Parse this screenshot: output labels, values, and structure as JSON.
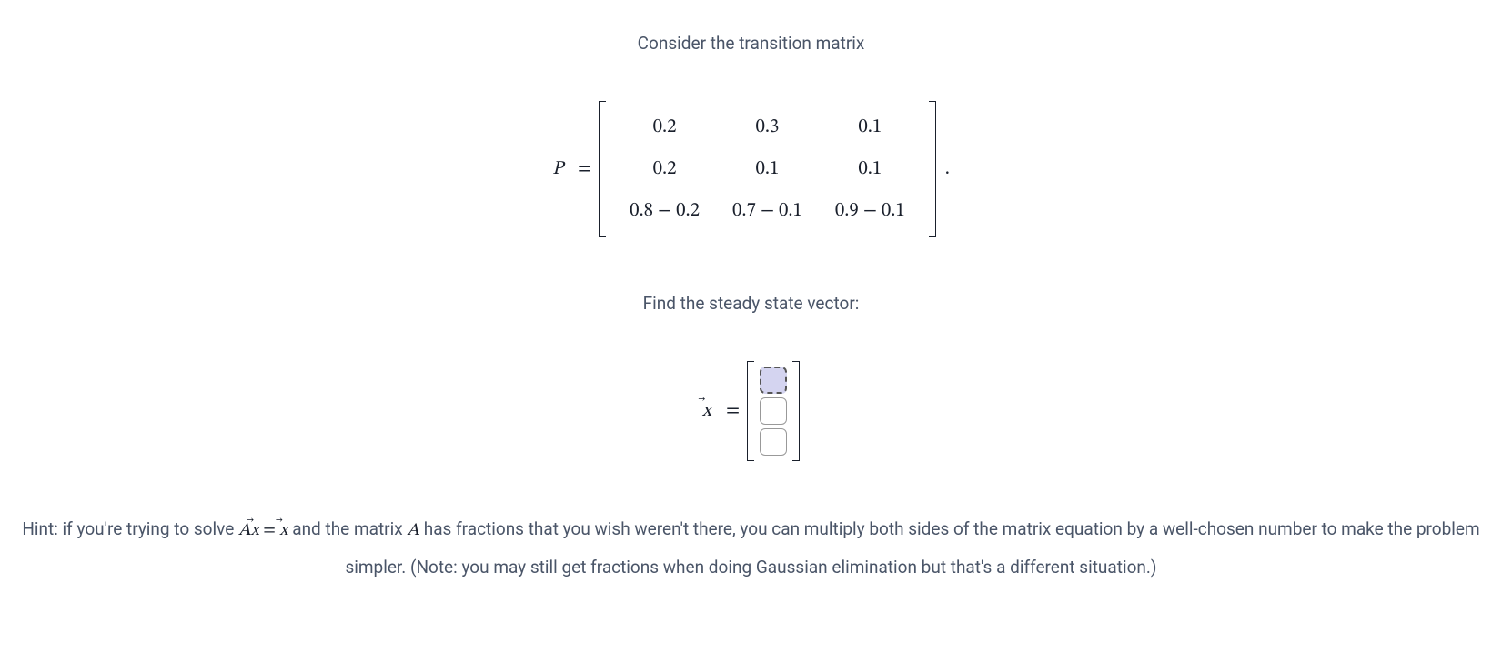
{
  "intro": "Consider the transition matrix",
  "matrix": {
    "label": "P",
    "equals": "=",
    "rows": [
      [
        "0.2",
        "0.3",
        "0.1"
      ],
      [
        "0.2",
        "0.1",
        "0.1"
      ],
      [
        "0.8 − 0.2",
        "0.7 − 0.1",
        "0.9 − 0.1"
      ]
    ],
    "period": "."
  },
  "find": "Find the steady state vector:",
  "vector": {
    "label": "x",
    "equals": "="
  },
  "hint": {
    "part1": "Hint: if you're trying to solve ",
    "eq1_lhs": "A",
    "eq1_vec1": "x",
    "eq1_eq": " = ",
    "eq1_vec2": "x",
    "part2": " and the matrix ",
    "matA": "A",
    "part3": " has fractions that you wish weren't there, you can multiply both sides of the matrix equation by a well-chosen number to make the problem simpler. (Note: you may still get fractions when doing Gaussian elimination but that's a different situation.)"
  }
}
